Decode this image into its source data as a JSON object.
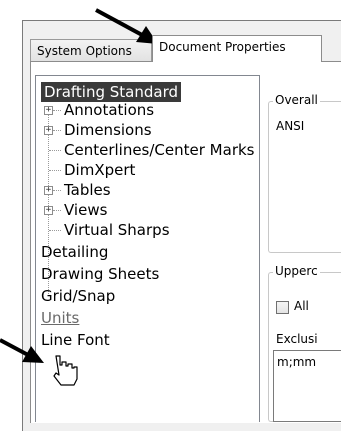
{
  "tabs": [
    {
      "label": "System Options"
    },
    {
      "label": "Document Properties"
    }
  ],
  "tree": {
    "items": [
      {
        "label": "Drafting Standard"
      },
      {
        "label": "Annotations"
      },
      {
        "label": "Dimensions"
      },
      {
        "label": "Centerlines/Center Marks"
      },
      {
        "label": "DimXpert"
      },
      {
        "label": "Tables"
      },
      {
        "label": "Views"
      },
      {
        "label": "Virtual Sharps"
      },
      {
        "label": "Detailing"
      },
      {
        "label": "Drawing Sheets"
      },
      {
        "label": "Grid/Snap"
      },
      {
        "label": "Units"
      },
      {
        "label": "Line Font"
      }
    ]
  },
  "right": {
    "overall_group_label": "Overall",
    "overall_value": "ANSI",
    "upper_group_label": "Upperc",
    "all_checkbox_label": "All",
    "exclusion_label": "Exclusi",
    "exclusion_value": "m;mm"
  },
  "colors": {
    "selection": "#3a3a3a",
    "arrow": "#000000"
  }
}
